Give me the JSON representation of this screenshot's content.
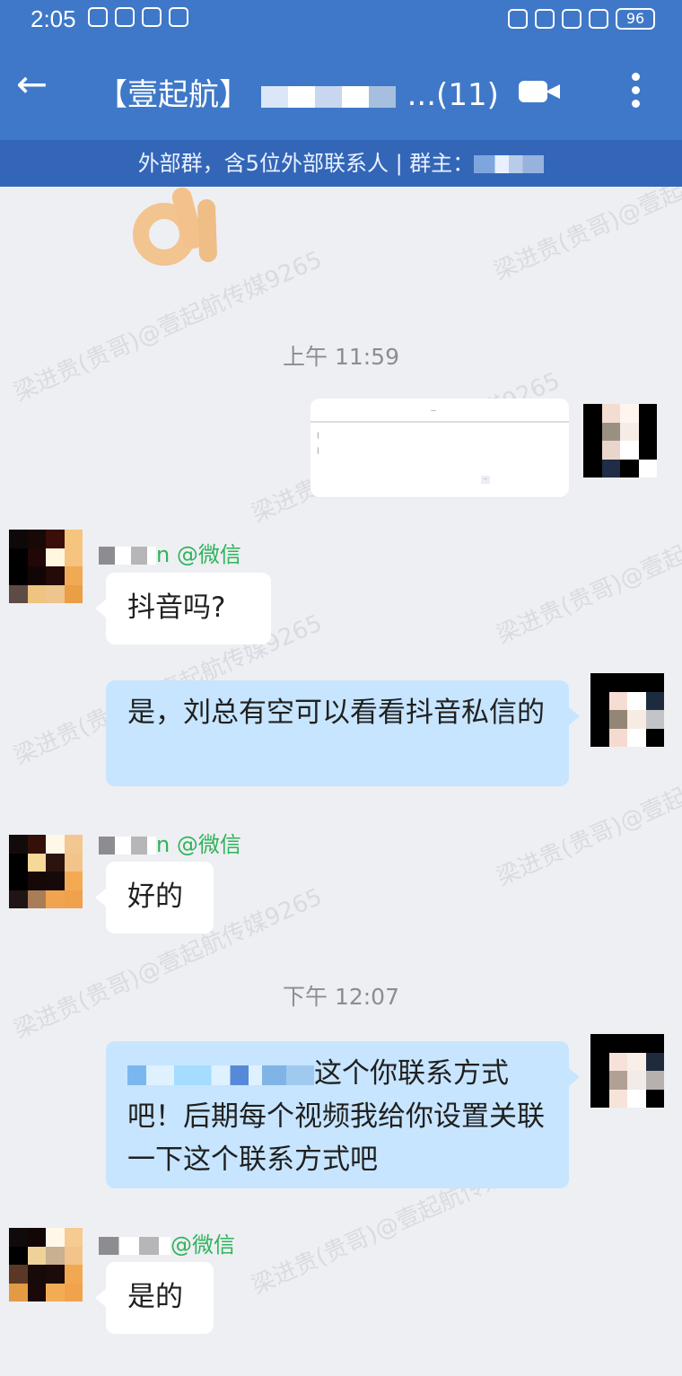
{
  "status": {
    "time": "2:05",
    "battery": "96"
  },
  "header": {
    "title_prefix": "【壹起航】",
    "title_suffix": "...(11)",
    "subtitle": "外部群，含5位外部联系人 | 群主："
  },
  "messages": {
    "time_1": "上午 11:59",
    "sender_suffix": "n @微信",
    "msg_1": "抖音吗?",
    "msg_2": "是，刘总有空可以看看抖音私信的",
    "sender_suffix_2": "n @微信",
    "msg_3": "好的",
    "time_2": "下午 12:07",
    "msg_4_tail": "这个你联系方式吧！后期每个视频我给你设置关联一下这个联系方式吧",
    "sender_suffix_3": "@微信",
    "msg_5": "是的"
  },
  "watermark": "梁进贵(贵哥)@壹起航传媒9265",
  "icons": {
    "back": "back-arrow-icon",
    "video": "video-call-icon",
    "more": "more-vertical-icon"
  },
  "colors": {
    "primary": "#3F78C8",
    "bubble_me": "#C7E5FF",
    "chat_bg": "#EEEFF3",
    "wechat_green": "#2FB35A"
  }
}
